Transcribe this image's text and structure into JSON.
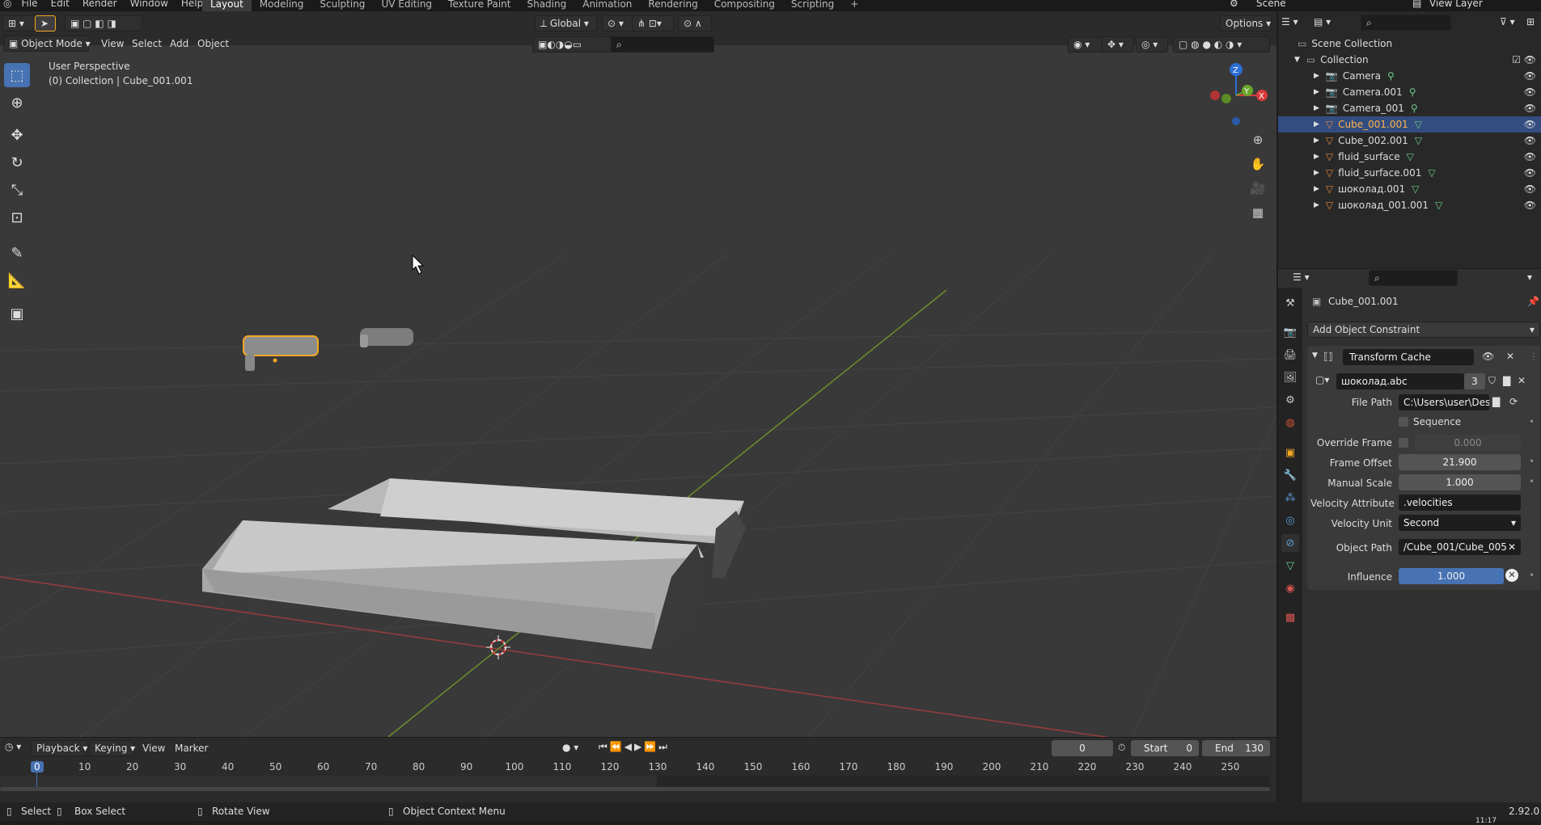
{
  "topbar": {
    "menus": [
      "File",
      "Edit",
      "Render",
      "Window",
      "Help"
    ],
    "workspaces": [
      "Layout",
      "Modeling",
      "Sculpting",
      "UV Editing",
      "Texture Paint",
      "Shading",
      "Animation",
      "Rendering",
      "Compositing",
      "Scripting"
    ],
    "active_workspace": "Layout",
    "add_tab": "+",
    "scene": "Scene",
    "view_layer": "View Layer"
  },
  "viewport_header": {
    "mode": "Object Mode",
    "menus": [
      "View",
      "Select",
      "Add",
      "Object"
    ],
    "orientation": "Global",
    "options": "Options"
  },
  "viewport": {
    "perspective": "User Perspective",
    "collection_info": "(0) Collection | Cube_001.001",
    "gizmo": {
      "x": "X",
      "y": "Y",
      "z": "Z"
    }
  },
  "outliner": {
    "scene_collection": "Scene Collection",
    "collection": "Collection",
    "items": [
      {
        "name": "Camera",
        "type": "camera",
        "selected": false
      },
      {
        "name": "Camera.001",
        "type": "camera",
        "selected": false
      },
      {
        "name": "Camera_001",
        "type": "camera",
        "selected": false
      },
      {
        "name": "Cube_001.001",
        "type": "mesh",
        "selected": true
      },
      {
        "name": "Cube_002.001",
        "type": "mesh",
        "selected": false
      },
      {
        "name": "fluid_surface",
        "type": "mesh",
        "selected": false
      },
      {
        "name": "fluid_surface.001",
        "type": "mesh",
        "selected": false
      },
      {
        "name": "шоколад.001",
        "type": "mesh",
        "selected": false
      },
      {
        "name": "шоколад_001.001",
        "type": "mesh",
        "selected": false
      }
    ]
  },
  "properties": {
    "object_name": "Cube_001.001",
    "add_constraint": "Add Object Constraint",
    "constraint_name": "Transform Cache",
    "cache_file": "шоколад.abc",
    "cache_users": "3",
    "fields": {
      "file_path_label": "File Path",
      "file_path": "C:\\Users\\user\\Des...",
      "sequence_label": "Sequence",
      "override_frame_label": "Override Frame",
      "override_frame": "0.000",
      "frame_offset_label": "Frame Offset",
      "frame_offset": "21.900",
      "manual_scale_label": "Manual Scale",
      "manual_scale": "1.000",
      "velocity_attr_label": "Velocity Attribute",
      "velocity_attr": ".velocities",
      "velocity_unit_label": "Velocity Unit",
      "velocity_unit": "Second",
      "object_path_label": "Object Path",
      "object_path": "/Cube_001/Cube_005",
      "influence_label": "Influence",
      "influence": "1.000"
    }
  },
  "timeline": {
    "menus": [
      "Playback",
      "Keying",
      "View",
      "Marker"
    ],
    "current_frame": "0",
    "start_label": "Start",
    "start": "0",
    "end_label": "End",
    "end": "130",
    "ticks": [
      "0",
      "10",
      "20",
      "30",
      "40",
      "50",
      "60",
      "70",
      "80",
      "90",
      "100",
      "110",
      "120",
      "130",
      "140",
      "150",
      "160",
      "170",
      "180",
      "190",
      "200",
      "210",
      "220",
      "230",
      "240",
      "250"
    ]
  },
  "statusbar": {
    "select": "Select",
    "box_select": "Box Select",
    "rotate_view": "Rotate View",
    "context_menu": "Object Context Menu",
    "version": "2.92.0",
    "time": "11:17"
  },
  "colors": {
    "accent": "#4772b3",
    "selection": "#f5a623",
    "viewport_bg": "#393939",
    "panel": "#303030"
  }
}
